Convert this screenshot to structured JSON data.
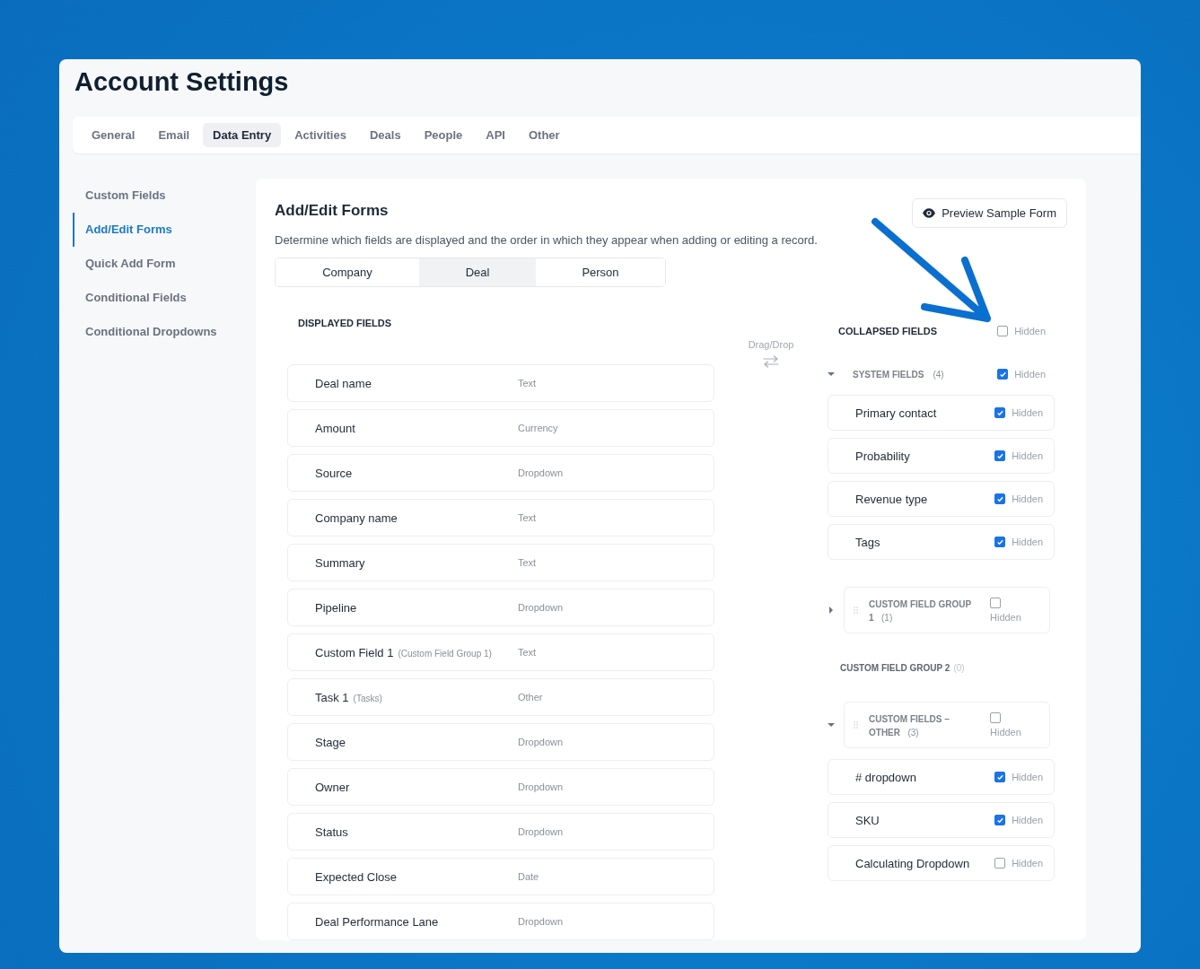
{
  "page": {
    "title": "Account Settings"
  },
  "tabs": [
    {
      "label": "General",
      "selected": false
    },
    {
      "label": "Email",
      "selected": false
    },
    {
      "label": "Data Entry",
      "selected": true
    },
    {
      "label": "Activities",
      "selected": false
    },
    {
      "label": "Deals",
      "selected": false
    },
    {
      "label": "People",
      "selected": false
    },
    {
      "label": "API",
      "selected": false
    },
    {
      "label": "Other",
      "selected": false
    }
  ],
  "sidebar": {
    "items": [
      {
        "label": "Custom Fields",
        "selected": false
      },
      {
        "label": "Add/Edit Forms",
        "selected": true
      },
      {
        "label": "Quick Add Form",
        "selected": false
      },
      {
        "label": "Conditional Fields",
        "selected": false
      },
      {
        "label": "Conditional Dropdowns",
        "selected": false
      }
    ]
  },
  "panel": {
    "title": "Add/Edit Forms",
    "preview_button": "Preview Sample Form",
    "description": "Determine which fields are displayed and the order in which they appear when adding or editing a record.",
    "segments": [
      {
        "label": "Company",
        "selected": false
      },
      {
        "label": "Deal",
        "selected": true
      },
      {
        "label": "Person",
        "selected": false
      }
    ],
    "drag_drop": "Drag/Drop",
    "displayed": {
      "title": "DISPLAYED FIELDS",
      "rows": [
        {
          "name": "Deal name",
          "type": "Text"
        },
        {
          "name": "Amount",
          "type": "Currency"
        },
        {
          "name": "Source",
          "type": "Dropdown"
        },
        {
          "name": "Company name",
          "type": "Text"
        },
        {
          "name": "Summary",
          "type": "Text"
        },
        {
          "name": "Pipeline",
          "type": "Dropdown"
        },
        {
          "name": "Custom Field 1",
          "note": "(Custom Field Group 1)",
          "type": "Text"
        },
        {
          "name": "Task 1",
          "note": "(Tasks)",
          "type": "Other"
        },
        {
          "name": "Stage",
          "type": "Dropdown"
        },
        {
          "name": "Owner",
          "type": "Dropdown"
        },
        {
          "name": "Status",
          "type": "Dropdown"
        },
        {
          "name": "Expected Close",
          "type": "Date"
        },
        {
          "name": "Deal Performance Lane",
          "type": "Dropdown"
        }
      ]
    },
    "collapsed": {
      "title": "COLLAPSED FIELDS",
      "hidden": false,
      "hidden_label": "Hidden",
      "groups": [
        {
          "kind": "section",
          "name": "SYSTEM FIELDS",
          "count": "(4)",
          "expanded": true,
          "hidden": true,
          "hidden_label": "Hidden",
          "fields": [
            {
              "name": "Primary contact",
              "hidden": true,
              "hidden_label": "Hidden"
            },
            {
              "name": "Probability",
              "hidden": true,
              "hidden_label": "Hidden"
            },
            {
              "name": "Revenue type",
              "hidden": true,
              "hidden_label": "Hidden"
            },
            {
              "name": "Tags",
              "hidden": true,
              "hidden_label": "Hidden"
            }
          ]
        },
        {
          "kind": "card",
          "name": "CUSTOM FIELD GROUP 1",
          "count": "(1)",
          "expanded": false,
          "hidden": false,
          "hidden_label": "Hidden"
        },
        {
          "kind": "label",
          "name": "CUSTOM FIELD GROUP 2",
          "count": "(0)"
        },
        {
          "kind": "card",
          "name": "CUSTOM FIELDS – OTHER",
          "count": "(3)",
          "expanded": true,
          "hidden": false,
          "hidden_label": "Hidden",
          "fields": [
            {
              "name": "# dropdown",
              "hidden": true,
              "hidden_label": "Hidden"
            },
            {
              "name": "SKU",
              "hidden": true,
              "hidden_label": "Hidden"
            },
            {
              "name": "Calculating Dropdown",
              "hidden": false,
              "hidden_label": "Hidden"
            }
          ]
        }
      ]
    }
  }
}
